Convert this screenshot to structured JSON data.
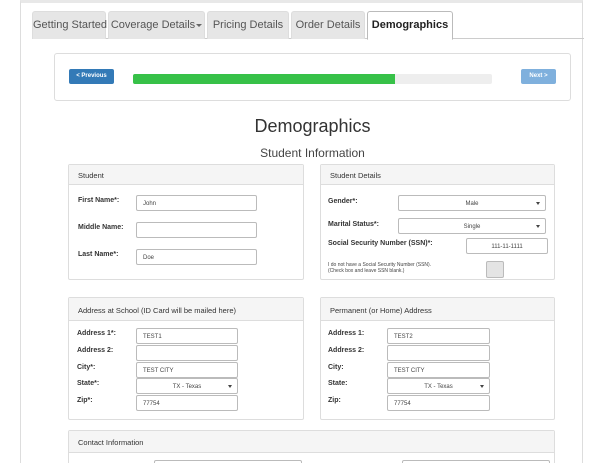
{
  "tabs": [
    {
      "label": "Getting Started",
      "dropdown": true
    },
    {
      "label": "Coverage Details",
      "dropdown": true
    },
    {
      "label": "Pricing Details",
      "dropdown": false
    },
    {
      "label": "Order Details",
      "dropdown": false
    },
    {
      "label": "Demographics",
      "dropdown": false,
      "active": true
    }
  ],
  "progress": {
    "previous_label": "< Previous",
    "next_label": "Next >",
    "percent": 73
  },
  "page_title": "Demographics",
  "section_title": "Student Information",
  "student": {
    "header": "Student",
    "first_name_label": "First Name*:",
    "first_name": "John",
    "middle_name_label": "Middle Name:",
    "middle_name": "",
    "last_name_label": "Last Name*:",
    "last_name": "Doe"
  },
  "student_details": {
    "header": "Student Details",
    "gender_label": "Gender*:",
    "gender": "Male",
    "marital_label": "Marital Status*:",
    "marital": "Single",
    "ssn_label": "Social Security Number (SSN)*:",
    "ssn": "111-11-1111",
    "no_ssn_line1": "I do not have a Social Security Number (SSN).",
    "no_ssn_line2": "(Check box and leave SSN blank.)"
  },
  "school_address": {
    "header": "Address at School (ID Card will be mailed here)",
    "address1_label": "Address 1*:",
    "address1": "TEST1",
    "address2_label": "Address 2:",
    "address2": "",
    "city_label": "City*:",
    "city": "TEST CITY",
    "state_label": "State*:",
    "state": "TX - Texas",
    "zip_label": "Zip*:",
    "zip": "77754"
  },
  "home_address": {
    "header": "Permanent (or Home) Address",
    "address1_label": "Address 1:",
    "address1": "TEST2",
    "address2_label": "Address 2:",
    "address2": "",
    "city_label": "City:",
    "city": "TEST CITY",
    "state_label": "State:",
    "state": "TX - Texas",
    "zip_label": "Zip:",
    "zip": "77754"
  },
  "contact": {
    "header": "Contact Information"
  }
}
